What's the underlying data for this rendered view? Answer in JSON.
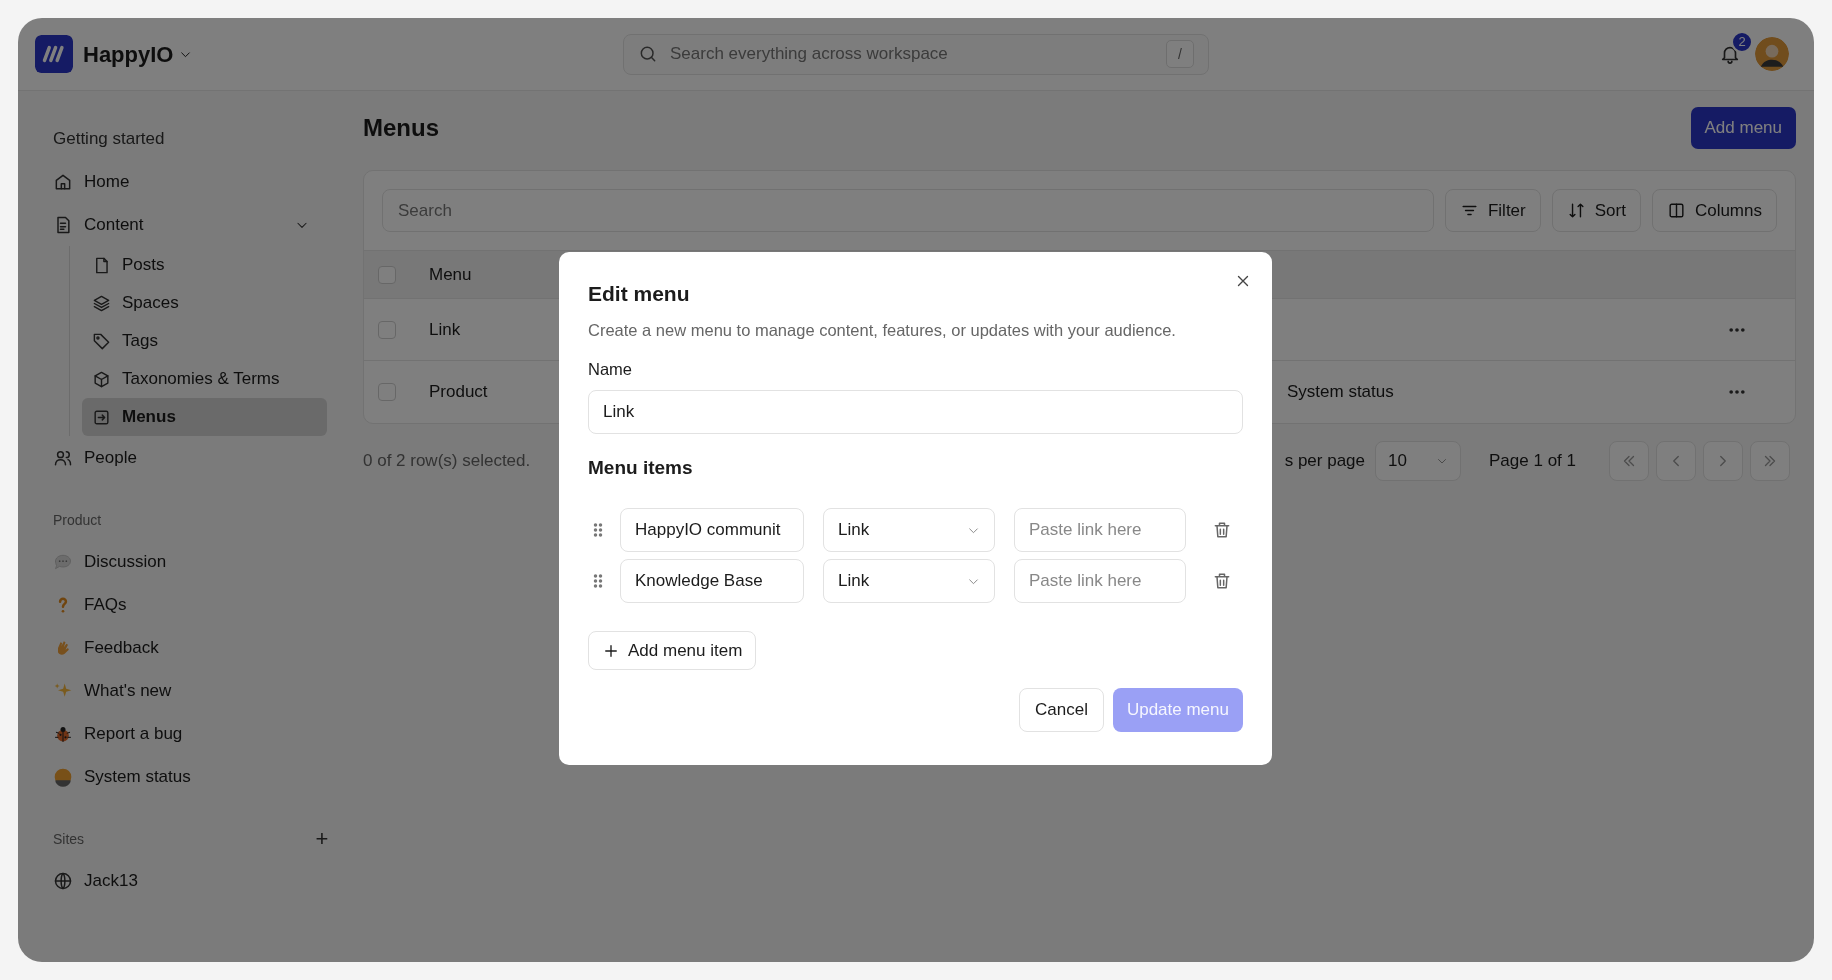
{
  "app": {
    "name": "HappyIO"
  },
  "search": {
    "placeholder": "Search everything across workspace",
    "shortcut": "/"
  },
  "notifications": {
    "count": "2"
  },
  "sidebar": {
    "sections": [
      {
        "title": "Getting started",
        "items": [
          {
            "label": "Home",
            "selected": false
          },
          {
            "label": "Content",
            "selected": false,
            "expanded": true,
            "children": [
              {
                "label": "Posts",
                "selected": false
              },
              {
                "label": "Spaces",
                "selected": false
              },
              {
                "label": "Tags",
                "selected": false
              },
              {
                "label": "Taxonomies & Terms",
                "selected": false
              },
              {
                "label": "Menus",
                "selected": true
              }
            ]
          },
          {
            "label": "People",
            "selected": false
          }
        ]
      },
      {
        "title": "Product",
        "items": [
          {
            "label": "Discussion",
            "selected": false
          },
          {
            "label": "FAQs",
            "selected": false
          },
          {
            "label": "Feedback",
            "selected": false
          },
          {
            "label": "What's new",
            "selected": false
          },
          {
            "label": "Report a bug",
            "selected": false
          },
          {
            "label": "System status",
            "selected": false
          }
        ]
      },
      {
        "title": "Sites",
        "add_button": "+",
        "items": [
          {
            "label": "Jack13",
            "selected": false
          }
        ]
      }
    ]
  },
  "page": {
    "title": "Menus",
    "add_button": "Add menu"
  },
  "table": {
    "search_placeholder": "Search",
    "tools": [
      "Filter",
      "Sort",
      "Columns"
    ],
    "columns": [
      "Menu"
    ],
    "header_checked": false,
    "rows": [
      {
        "menu": "Link",
        "checked": false
      },
      {
        "menu": "Product",
        "column_2": "System status",
        "checked": false
      }
    ],
    "selection": "0 of 2 row(s) selected.",
    "rows_per_page_label": "s per page",
    "page_size": "10",
    "page_info": "Page 1 of 1"
  },
  "dialog": {
    "title": "Edit menu",
    "description": "Create a new menu to manage content, features, or updates with your audience.",
    "name_label": "Name",
    "name_value": "Link",
    "items_title": "Menu items",
    "items": [
      {
        "label": "HappyIO communit",
        "type": "Link",
        "link_placeholder": "Paste link here"
      },
      {
        "label": "Knowledge Base",
        "type": "Link",
        "link_placeholder": "Paste link here"
      }
    ],
    "add_item": "Add menu item",
    "cancel": "Cancel",
    "submit": {
      "label": "Update menu",
      "disabled": true
    }
  }
}
